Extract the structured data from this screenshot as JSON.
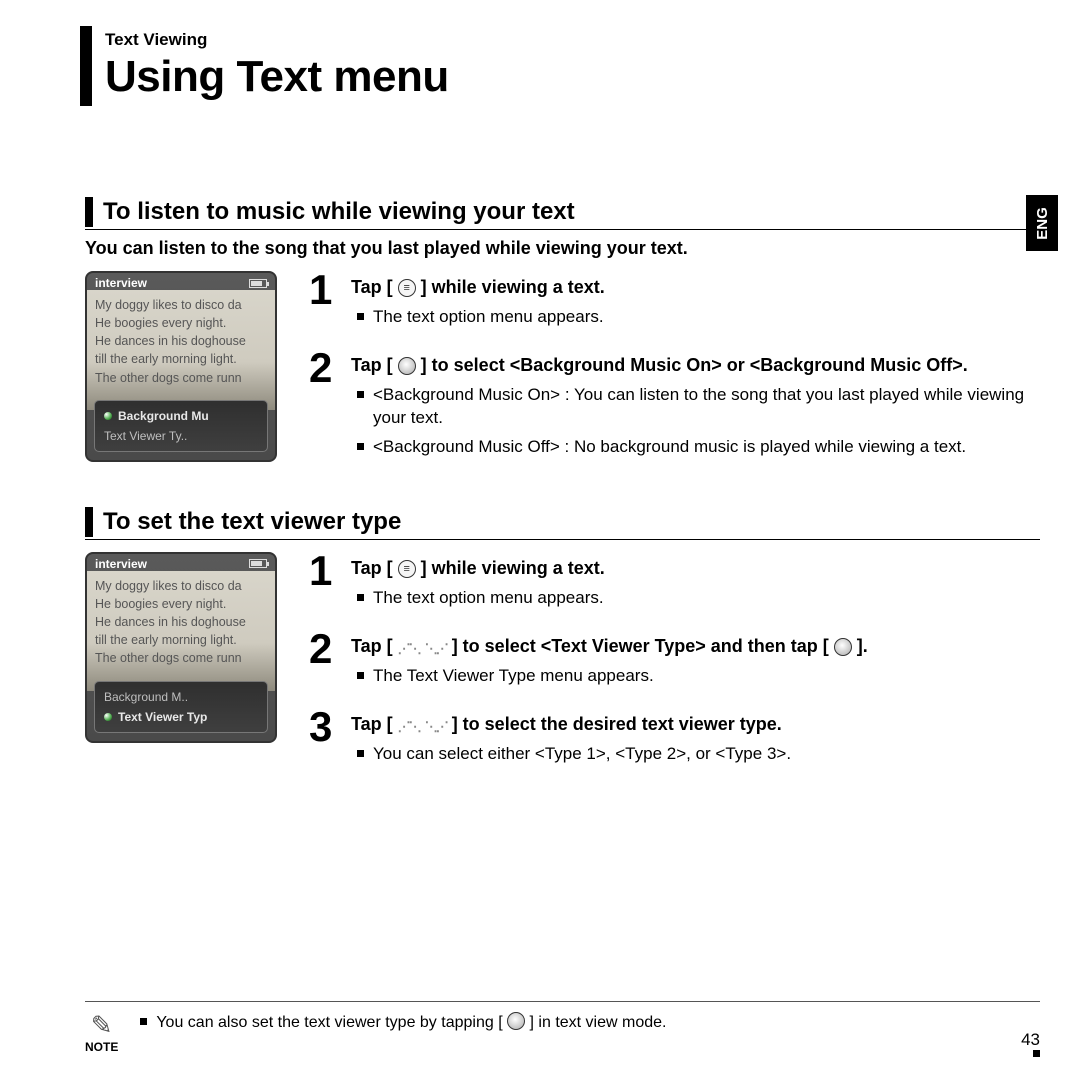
{
  "breadcrumb": "Text Viewing",
  "title": "Using Text menu",
  "langTab": "ENG",
  "section1": {
    "heading": "To listen to music while viewing your text",
    "sub": "You can listen to the song that you last played while viewing your text.",
    "device": {
      "title": "interview",
      "lines": [
        "My doggy likes to disco da",
        "He boogies every night.",
        "He dances in his doghouse",
        "till the early morning light.",
        "The other dogs come runn"
      ],
      "menu": {
        "row1": "Background Mu",
        "row2": "Text Viewer Ty.."
      }
    },
    "steps": [
      {
        "num": "1",
        "pre": "Tap [ ",
        "post": " ] while viewing a text.",
        "bullets": [
          "The text option menu appears."
        ]
      },
      {
        "num": "2",
        "pre": "Tap [ ",
        "post": " ] to select <Background Music On> or <Background Music Off>.",
        "bullets": [
          "<Background Music On> : You can listen to the song that you last played while viewing your text.",
          "<Background Music Off> : No background music is played while viewing a text."
        ]
      }
    ]
  },
  "section2": {
    "heading": "To set the text viewer type",
    "device": {
      "title": "interview",
      "lines": [
        "My doggy likes to disco da",
        "He boogies every night.",
        "He dances in his doghouse",
        "till the early morning light.",
        "The other dogs come runn"
      ],
      "menu": {
        "row1": "Background M..",
        "row2": "Text Viewer Typ"
      }
    },
    "steps": [
      {
        "num": "1",
        "pre": "Tap [ ",
        "post": " ] while viewing a text.",
        "bullets": [
          "The text option menu appears."
        ]
      },
      {
        "num": "2",
        "pre": "Tap [ ",
        "mid": " ] to select <Text Viewer Type> and then tap [ ",
        "post": " ].",
        "bullets": [
          "The Text Viewer Type menu appears."
        ]
      },
      {
        "num": "3",
        "pre": "Tap [ ",
        "post": " ] to select the desired text viewer type.",
        "bullets": [
          "You can select either <Type 1>, <Type 2>, or <Type 3>."
        ]
      }
    ]
  },
  "note": {
    "label": "NOTE",
    "pre": "You can also set the text viewer type by tapping [ ",
    "post": " ] in text view mode."
  },
  "pageNumber": "43"
}
